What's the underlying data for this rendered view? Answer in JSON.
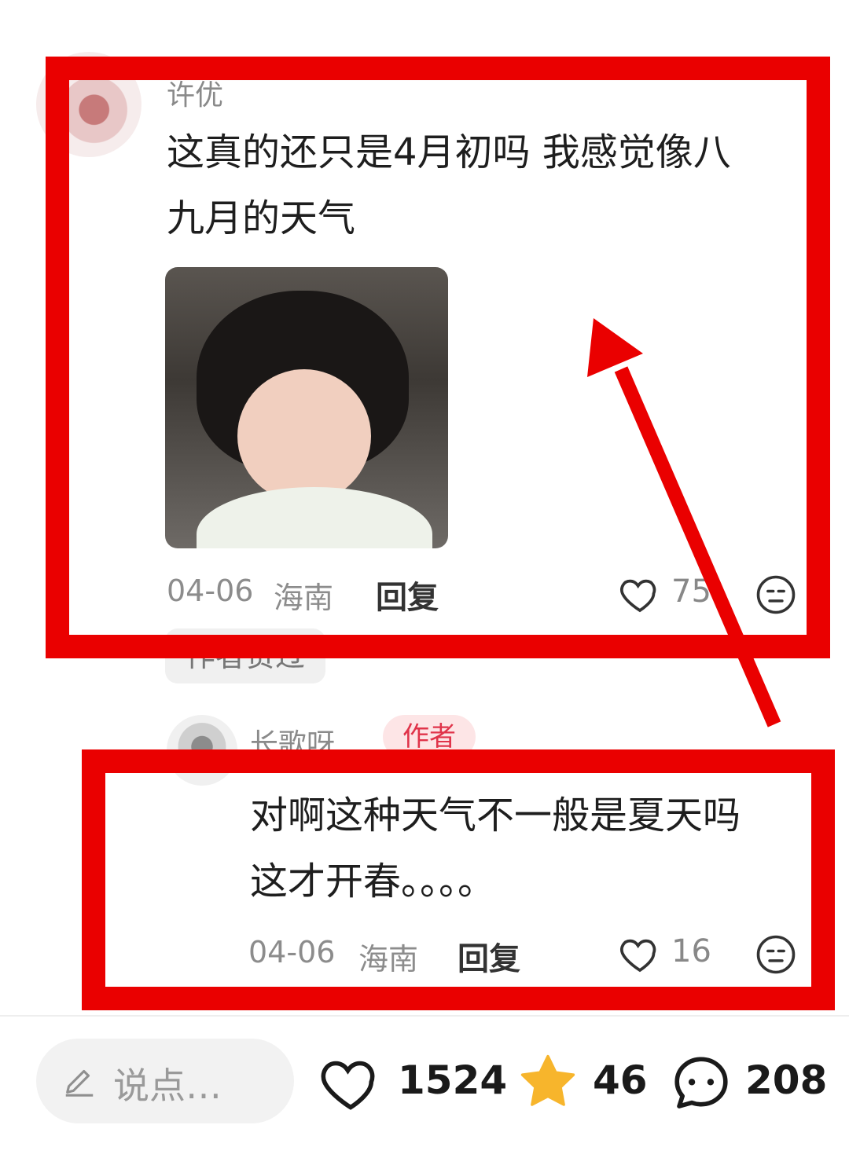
{
  "comment1": {
    "username": "许优",
    "text_line1": "这真的还只是4月初吗 我感觉像八",
    "text_line2": "九月的天气",
    "date": "04-06",
    "location": "海南",
    "reply_label": "回复",
    "like_count": "75",
    "author_seen_label": "作者赞过"
  },
  "reply1": {
    "username": "长歌呀",
    "author_badge": "作者",
    "text_line1": "对啊这种天气不一般是夏天吗",
    "text_line2": "这才开春。。。。",
    "date": "04-06",
    "location": "海南",
    "reply_label": "回复",
    "like_count": "16"
  },
  "bottom_bar": {
    "input_placeholder": "说点…",
    "like_count": "1524",
    "star_count": "46",
    "comment_count": "208"
  },
  "colors": {
    "highlight_red": "#ea0000",
    "badge_red": "#e0344a",
    "star_yellow": "#f7b52c"
  },
  "icons": [
    "heart-icon",
    "dislike-face-icon",
    "pencil-icon",
    "star-icon",
    "chat-icon"
  ]
}
